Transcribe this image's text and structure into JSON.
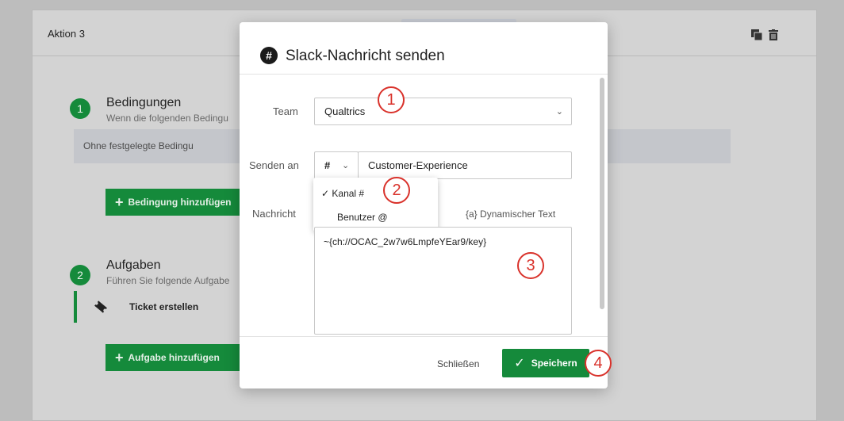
{
  "background": {
    "action_title": "Aktion 3",
    "conditions": {
      "number": "1",
      "title": "Bedingungen",
      "subtitle": "Wenn die folgenden Bedingu",
      "no_conditions_text": "Ohne festgelegte Bedingu",
      "add_condition_label": "Bedingung hinzufügen"
    },
    "tasks": {
      "number": "2",
      "title": "Aufgaben",
      "subtitle": "Führen Sie folgende Aufgabe",
      "ticket_label": "Ticket erstellen",
      "add_task_label": "Aufgabe hinzufügen"
    },
    "icons": [
      "copy-icon",
      "trash-icon"
    ]
  },
  "modal": {
    "icon": "slack-icon",
    "icon_glyph": "#",
    "title": "Slack-Nachricht senden",
    "team_label": "Team",
    "team_value": "Qualtrics",
    "send_to_label": "Senden an",
    "channel_type_value": "#",
    "channel_value": "Customer-Experience",
    "channel_type_options": [
      {
        "label": "Kanal #",
        "checked": true
      },
      {
        "label": "Benutzer @",
        "checked": false
      }
    ],
    "message_label": "Nachricht",
    "dynamic_text_label": "{a} Dynamischer Text",
    "message_value": "~{ch://OCAC_2w7w6LmpfeYEar9/key}",
    "close_label": "Schließen",
    "save_label": "Speichern"
  },
  "callouts": [
    "1",
    "2",
    "3",
    "4"
  ],
  "colors": {
    "accent_green": "#158a3b",
    "callout_red": "#d9322b"
  }
}
